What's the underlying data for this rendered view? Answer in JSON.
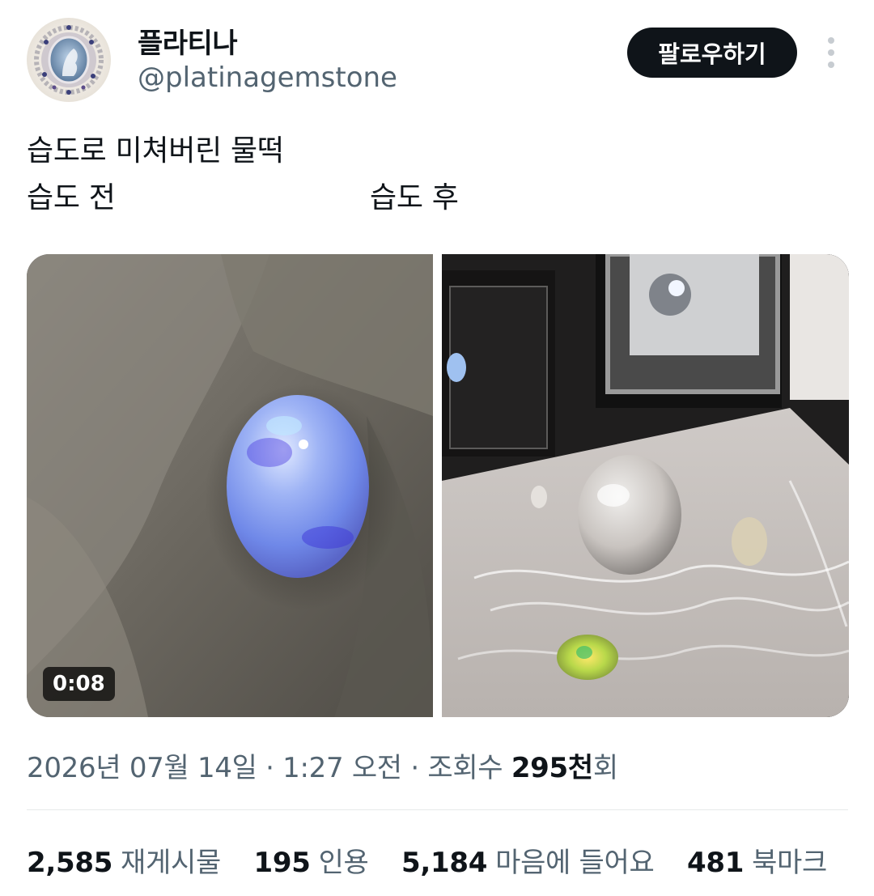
{
  "user": {
    "display_name": "플라티나",
    "handle": "@platinagemstone",
    "avatar_icon": "cameo-brooch-avatar"
  },
  "follow_button": {
    "label": "팔로우하기"
  },
  "more_icon": "more-vertical-icon",
  "tweet": {
    "line1": "습도로 미쳐버린 물떡",
    "label_before": "습도 전",
    "label_after": "습도 후"
  },
  "media": {
    "video_duration": "0:08",
    "left_image": "opal-on-fabric",
    "right_image": "clear-opal-in-gem-box"
  },
  "meta": {
    "date": "2026년 07월 14일",
    "separator": "·",
    "time": "1:27 오전",
    "views_label": "조회수",
    "views_count": "295천",
    "views_suffix": "회"
  },
  "stats": [
    {
      "count": "2,585",
      "label": "재게시물"
    },
    {
      "count": "195",
      "label": "인용"
    },
    {
      "count": "5,184",
      "label": "마음에 들어요"
    },
    {
      "count": "481",
      "label": "북마크"
    }
  ],
  "colors": {
    "text_primary": "#0f1419",
    "text_secondary": "#536471",
    "divider": "#e7e9ea",
    "button_bg": "#0f1419"
  }
}
